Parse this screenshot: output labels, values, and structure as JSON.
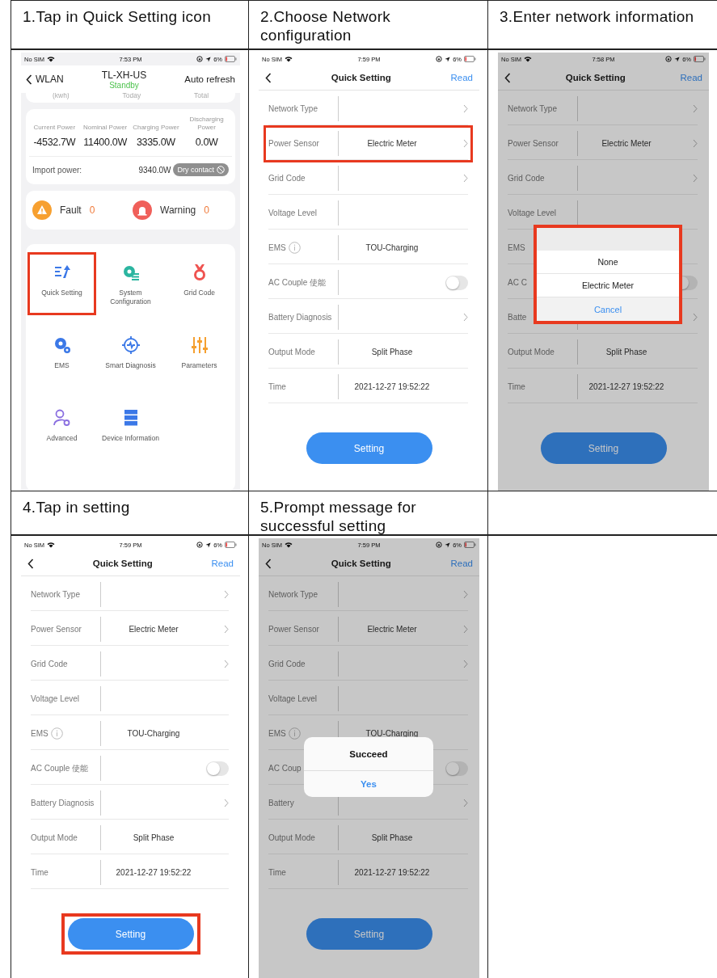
{
  "steps": [
    {
      "caption": "1.Tap in Quick Setting icon",
      "screen": {
        "kind": "device",
        "status": {
          "carrier": "No SIM",
          "time": "7:53 PM",
          "battery": "6%"
        },
        "back": "WLAN",
        "title": "TL-XH-US",
        "subtitle": "Standby",
        "action": "Auto refresh",
        "energy_headers": [
          "(kwh)",
          "Today",
          "Total"
        ],
        "power": [
          {
            "label": "Current Power",
            "value": "-4532.7W"
          },
          {
            "label": "Nominal Power",
            "value": "11400.0W"
          },
          {
            "label": "Charging Power",
            "value": "3335.0W"
          },
          {
            "label": "Discharging Power",
            "value": "0.0W"
          }
        ],
        "import_label": "Import power:",
        "import_value": "9340.0W",
        "dry_contact": {
          "label": "Dry contact",
          "disabled": true
        },
        "alerts": [
          {
            "kind": "fault",
            "label": "Fault",
            "count": "0"
          },
          {
            "kind": "warning",
            "label": "Warning",
            "count": "0"
          }
        ],
        "menu": [
          {
            "kind": "quick",
            "label": "Quick Setting",
            "highlighted": true
          },
          {
            "kind": "system",
            "label": "System Configuration",
            "highlighted": false
          },
          {
            "kind": "grid",
            "label": "Grid Code",
            "highlighted": false
          },
          {
            "kind": "ems",
            "label": "EMS",
            "highlighted": false
          },
          {
            "kind": "diagnosis",
            "label": "Smart Diagnosis",
            "highlighted": false
          },
          {
            "kind": "parameters",
            "label": "Parameters",
            "highlighted": false
          },
          {
            "kind": "advanced",
            "label": "Advanced",
            "highlighted": false
          },
          {
            "kind": "device",
            "label": "Device Information",
            "highlighted": false
          }
        ]
      }
    },
    {
      "caption": "2.Choose Network configuration",
      "screen": {
        "kind": "quick_setting",
        "dimmed": false,
        "status": {
          "carrier": "No SIM",
          "time": "7:59 PM",
          "battery": "6%"
        },
        "title": "Quick Setting",
        "action": "Read",
        "rows": [
          {
            "kind": "chevron",
            "label": "Network Type",
            "highlighted": false
          },
          {
            "kind": "chevron",
            "label": "Power Sensor",
            "value": "Electric Meter",
            "highlighted": true
          },
          {
            "kind": "chevron",
            "label": "Grid Code",
            "highlighted": false
          },
          {
            "kind": "plain",
            "label": "Voltage Level",
            "highlighted": false
          },
          {
            "kind": "info",
            "label": "EMS",
            "value": "TOU-Charging",
            "highlighted": false
          },
          {
            "kind": "toggle",
            "label": "AC Couple 使能",
            "on": false,
            "highlighted": false
          },
          {
            "kind": "chevron",
            "label": "Battery Diagnosis",
            "highlighted": false
          },
          {
            "kind": "plain",
            "label": "Output Mode",
            "value": "Split Phase",
            "highlighted": false
          },
          {
            "kind": "plain",
            "label": "Time",
            "value": "2021-12-27 19:52:22",
            "highlighted": false
          }
        ],
        "button": {
          "label": "Setting",
          "highlighted": false
        }
      }
    },
    {
      "caption": "3.Enter network information",
      "screen": {
        "kind": "quick_setting",
        "dimmed": true,
        "status": {
          "carrier": "No SIM",
          "time": "7:58 PM",
          "battery": "6%"
        },
        "title": "Quick Setting",
        "action": "Read",
        "rows": [
          {
            "kind": "chevron",
            "label": "Network Type",
            "highlighted": false
          },
          {
            "kind": "chevron",
            "label": "Power Sensor",
            "value": "Electric Meter",
            "highlighted": false
          },
          {
            "kind": "chevron",
            "label": "Grid Code",
            "highlighted": false
          },
          {
            "kind": "plain",
            "label": "Voltage Level",
            "highlighted": false
          },
          {
            "kind": "plain",
            "label": "EMS",
            "highlighted": false
          },
          {
            "kind": "toggle",
            "label": "AC C",
            "on": false,
            "highlighted": false
          },
          {
            "kind": "chevron",
            "label": "Batte",
            "highlighted": false
          },
          {
            "kind": "plain",
            "label": "Output Mode",
            "value": "Split Phase",
            "highlighted": false
          },
          {
            "kind": "plain",
            "label": "Time",
            "value": "2021-12-27 19:52:22",
            "highlighted": false
          }
        ],
        "button": {
          "label": "Setting",
          "highlighted": false
        },
        "picker": {
          "options": [
            "None",
            "Electric Meter"
          ],
          "cancel": "Cancel",
          "highlighted": true
        }
      }
    },
    {
      "caption": "4.Tap in setting",
      "screen": {
        "kind": "quick_setting",
        "dimmed": false,
        "status": {
          "carrier": "No SIM",
          "time": "7:59 PM",
          "battery": "6%"
        },
        "title": "Quick Setting",
        "action": "Read",
        "rows": [
          {
            "kind": "chevron",
            "label": "Network Type",
            "highlighted": false
          },
          {
            "kind": "chevron",
            "label": "Power Sensor",
            "value": "Electric Meter",
            "highlighted": false
          },
          {
            "kind": "chevron",
            "label": "Grid Code",
            "highlighted": false
          },
          {
            "kind": "plain",
            "label": "Voltage Level",
            "highlighted": false
          },
          {
            "kind": "info",
            "label": "EMS",
            "value": "TOU-Charging",
            "highlighted": false
          },
          {
            "kind": "toggle",
            "label": "AC Couple 使能",
            "on": false,
            "highlighted": false
          },
          {
            "kind": "chevron",
            "label": "Battery Diagnosis",
            "highlighted": false
          },
          {
            "kind": "plain",
            "label": "Output Mode",
            "value": "Split Phase",
            "highlighted": false
          },
          {
            "kind": "plain",
            "label": "Time",
            "value": "2021-12-27 19:52:22",
            "highlighted": false
          }
        ],
        "button": {
          "label": "Setting",
          "highlighted": true
        }
      }
    },
    {
      "caption": "5.Prompt message for successful setting",
      "screen": {
        "kind": "quick_setting",
        "dimmed": true,
        "status": {
          "carrier": "No SIM",
          "time": "7:59 PM",
          "battery": "6%"
        },
        "title": "Quick Setting",
        "action": "Read",
        "rows": [
          {
            "kind": "chevron",
            "label": "Network Type",
            "highlighted": false
          },
          {
            "kind": "chevron",
            "label": "Power Sensor",
            "value": "Electric Meter",
            "highlighted": false
          },
          {
            "kind": "chevron",
            "label": "Grid Code",
            "highlighted": false
          },
          {
            "kind": "plain",
            "label": "Voltage Level",
            "highlighted": false
          },
          {
            "kind": "info",
            "label": "EMS",
            "value": "TOU-Charging",
            "highlighted": false
          },
          {
            "kind": "toggle",
            "label": "AC Coup",
            "on": false,
            "highlighted": false
          },
          {
            "kind": "chevron",
            "label": "Battery",
            "highlighted": false
          },
          {
            "kind": "plain",
            "label": "Output Mode",
            "value": "Split Phase",
            "highlighted": false
          },
          {
            "kind": "plain",
            "label": "Time",
            "value": "2021-12-27 19:52:22",
            "highlighted": false
          }
        ],
        "button": {
          "label": "Setting",
          "highlighted": false
        },
        "alert": {
          "title": "Succeed",
          "button": "Yes"
        }
      }
    }
  ]
}
